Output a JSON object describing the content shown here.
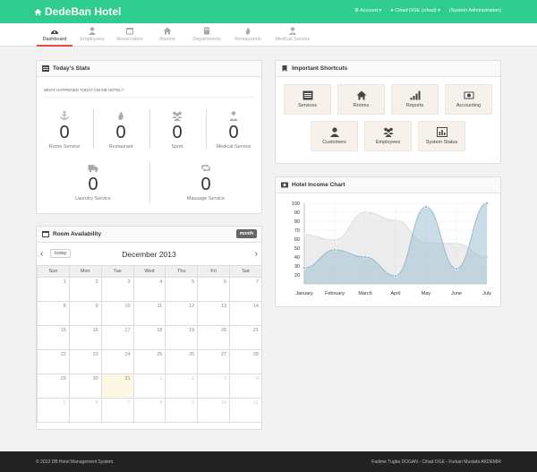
{
  "brand": {
    "title": "DedeBan Hotel"
  },
  "topbar": {
    "account": "Account",
    "user": "Cihad OGE (cihad)",
    "role": "(System Administration)"
  },
  "nav": [
    {
      "label": "Dashboard",
      "icon": "dashboard-icon"
    },
    {
      "label": "Employees",
      "icon": "user-icon"
    },
    {
      "label": "Reservation",
      "icon": "calendar-icon"
    },
    {
      "label": "Rooms",
      "icon": "home-icon"
    },
    {
      "label": "Departments",
      "icon": "building-icon"
    },
    {
      "label": "Restaurants",
      "icon": "fire-icon"
    },
    {
      "label": "Medical Service",
      "icon": "medical-icon"
    }
  ],
  "stats": {
    "title": "Today's Stats",
    "subtitle": "WHAT HAPPENED TODAY ON DB HOTEL?",
    "items": [
      {
        "label": "Room Service",
        "value": "0",
        "icon": "anchor-icon"
      },
      {
        "label": "Restaurant",
        "value": "0",
        "icon": "fire-icon"
      },
      {
        "label": "Sport",
        "value": "0",
        "icon": "group-icon"
      },
      {
        "label": "Medical Service",
        "value": "0",
        "icon": "medical-icon"
      },
      {
        "label": "Laundry Service",
        "value": "0",
        "icon": "truck-icon"
      },
      {
        "label": "Massage Service",
        "value": "0",
        "icon": "retweet-icon"
      }
    ]
  },
  "calendar": {
    "title": "Room Availability",
    "view_button": "month",
    "today_button": "today",
    "month_title": "December 2013",
    "weekdays": [
      "Sun",
      "Mon",
      "Tue",
      "Wed",
      "Thu",
      "Fri",
      "Sat"
    ],
    "weeks": [
      [
        "1",
        "2",
        "3",
        "4",
        "5",
        "6",
        "7"
      ],
      [
        "8",
        "9",
        "10",
        "11",
        "12",
        "13",
        "14"
      ],
      [
        "15",
        "16",
        "17",
        "18",
        "19",
        "20",
        "21"
      ],
      [
        "22",
        "23",
        "24",
        "25",
        "26",
        "27",
        "28"
      ],
      [
        "29",
        "30",
        "31",
        "1",
        "2",
        "3",
        "4"
      ],
      [
        "5",
        "6",
        "7",
        "8",
        "9",
        "10",
        "11"
      ]
    ]
  },
  "shortcuts": {
    "title": "Important Shortcuts",
    "items": [
      {
        "label": "Services",
        "icon": "list-icon"
      },
      {
        "label": "Rooms",
        "icon": "home-icon"
      },
      {
        "label": "Reports",
        "icon": "signal-icon"
      },
      {
        "label": "Accounting",
        "icon": "money-icon"
      },
      {
        "label": "Customers",
        "icon": "user-icon"
      },
      {
        "label": "Employees",
        "icon": "group-icon"
      },
      {
        "label": "System Status",
        "icon": "bar-chart-icon"
      }
    ]
  },
  "income": {
    "title": "Hotel Income Chart"
  },
  "chart_data": {
    "type": "area",
    "categories": [
      "January",
      "February",
      "March",
      "April",
      "May",
      "June",
      "July"
    ],
    "series": [
      {
        "values": [
          65,
          59,
          90,
          81,
          56,
          55,
          40
        ],
        "color": "#dcdcdc"
      },
      {
        "values": [
          28,
          48,
          40,
          19,
          96,
          27,
          100
        ],
        "color": "#97bbcd"
      }
    ],
    "ylim": [
      10,
      100
    ],
    "yticks": [
      "100",
      "90",
      "80",
      "70",
      "60",
      "50",
      "40",
      "30",
      "20"
    ],
    "grid": true
  },
  "footer": {
    "copyright": "© 2013 DB Hotel Management System.",
    "authors": "Fadime Tugba DOGAN - Cihad OGE - Furkan Mustafa AKDEMIR"
  },
  "colors": {
    "topbar": "#2ecc8e",
    "active": "#e74c3c",
    "shortcut_bg": "#f6f2eb"
  }
}
